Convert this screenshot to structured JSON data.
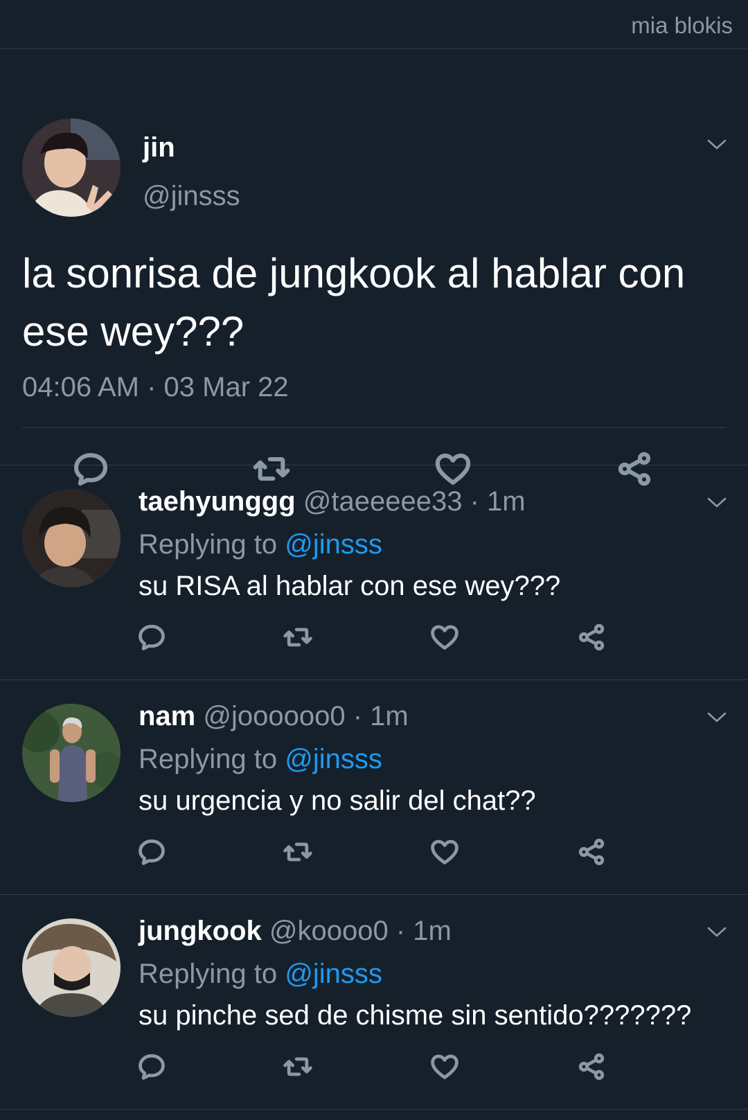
{
  "watermark": "mia blokis",
  "tweet": {
    "name": "jin",
    "handle": "@jinsss",
    "text": "la sonrisa de jungkook al hablar con ese wey???",
    "timestamp": "04:06 AM · 03 Mar 22"
  },
  "replies": [
    {
      "name": "taehyunggg",
      "meta": "@taeeeee33 · 1m",
      "replying_label": "Replying to",
      "mention": "@jinsss",
      "text": "su RISA al hablar con ese wey???"
    },
    {
      "name": "nam",
      "meta": "@joooooo0 · 1m",
      "replying_label": "Replying to",
      "mention": "@jinsss",
      "text": "su urgencia y no salir del chat??"
    },
    {
      "name": "jungkook",
      "meta": "@koooo0 · 1m",
      "replying_label": "Replying to",
      "mention": "@jinsss",
      "text": "su pinche sed de chisme sin sentido???????"
    }
  ],
  "icons": [
    "reply-icon",
    "retweet-icon",
    "like-icon",
    "share-icon",
    "chevron-down-icon"
  ],
  "colors": {
    "background": "#15202b",
    "muted": "#8b98a5",
    "accent": "#1d9bf0",
    "divider": "#2f3c4a"
  }
}
